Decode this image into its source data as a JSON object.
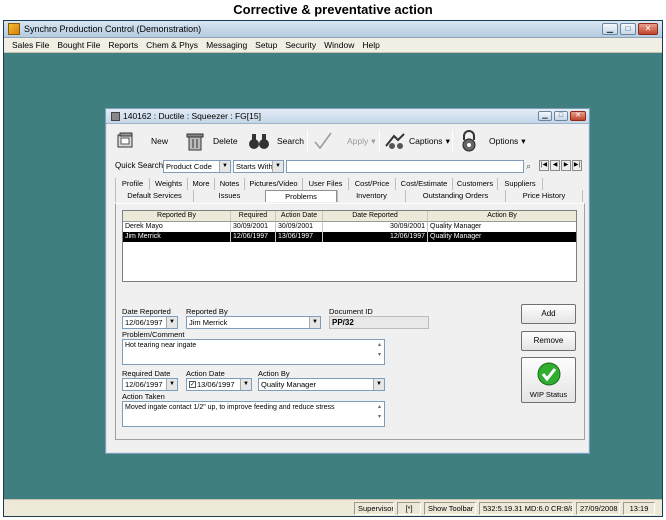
{
  "page_title": "Corrective & preventative action",
  "app": {
    "title": "Synchro Production Control (Demonstration)",
    "menu": [
      "Sales File",
      "Bought File",
      "Reports",
      "Chem & Phys",
      "Messaging",
      "Setup",
      "Security",
      "Window",
      "Help"
    ]
  },
  "status": {
    "user": "Supervisor",
    "flag": "[*]",
    "toolbar": "Show Toolbar",
    "version": "532:5.19.31 MD:6.0 CR:8/8.5",
    "date": "27/09/2008",
    "time": "13:19"
  },
  "window": {
    "title": "140162 : Ductile : Squeezer : FG[15]",
    "toolbar": {
      "new": "New",
      "delete": "Delete",
      "search": "Search",
      "apply": "Apply",
      "captions": "Captions",
      "options": "Options"
    },
    "quick_search": {
      "label": "Quick Search",
      "field": "Product Code",
      "mode": "Starts With",
      "value": ""
    },
    "tabs_row1": [
      "Profile",
      "Weights",
      "More",
      "Notes",
      "Pictures/Video",
      "User Files",
      "Cost/Price",
      "Cost/Estimate",
      "Customers",
      "Suppliers"
    ],
    "tabs_row2": [
      "Default Services",
      "Issues",
      "Problems",
      "Inventory",
      "Outstanding Orders",
      "Price History"
    ],
    "active_tab": "Problems",
    "grid": {
      "columns": [
        "Reported By",
        "Required",
        "Action Date",
        "Date Reported",
        "Action By"
      ],
      "rows": [
        [
          "Derek Mayo",
          "30/09/2001",
          "30/09/2001",
          "30/09/2001",
          "Quality Manager"
        ],
        [
          "Jim Merrick",
          "12/06/1997",
          "13/06/1997",
          "12/06/1997",
          "Quality Manager"
        ]
      ]
    },
    "form": {
      "date_reported_label": "Date Reported",
      "date_reported": "12/06/1997",
      "reported_by_label": "Reported By",
      "reported_by": "Jim Merrick",
      "document_id_label": "Document ID",
      "document_id": "PP/32",
      "problem_label": "Problem/Comment",
      "problem": "Hot tearing near ingate",
      "required_date_label": "Required Date",
      "required_date": "12/06/1997",
      "action_date_label": "Action Date",
      "action_date": "13/06/1997",
      "action_by_label": "Action By",
      "action_by": "Quality Manager",
      "action_taken_label": "Action Taken",
      "action_taken": "Moved ingate contact 1/2\" up, to improve feeding and reduce stress"
    },
    "buttons": {
      "add": "Add",
      "remove": "Remove",
      "wip": "WIP Status"
    }
  }
}
